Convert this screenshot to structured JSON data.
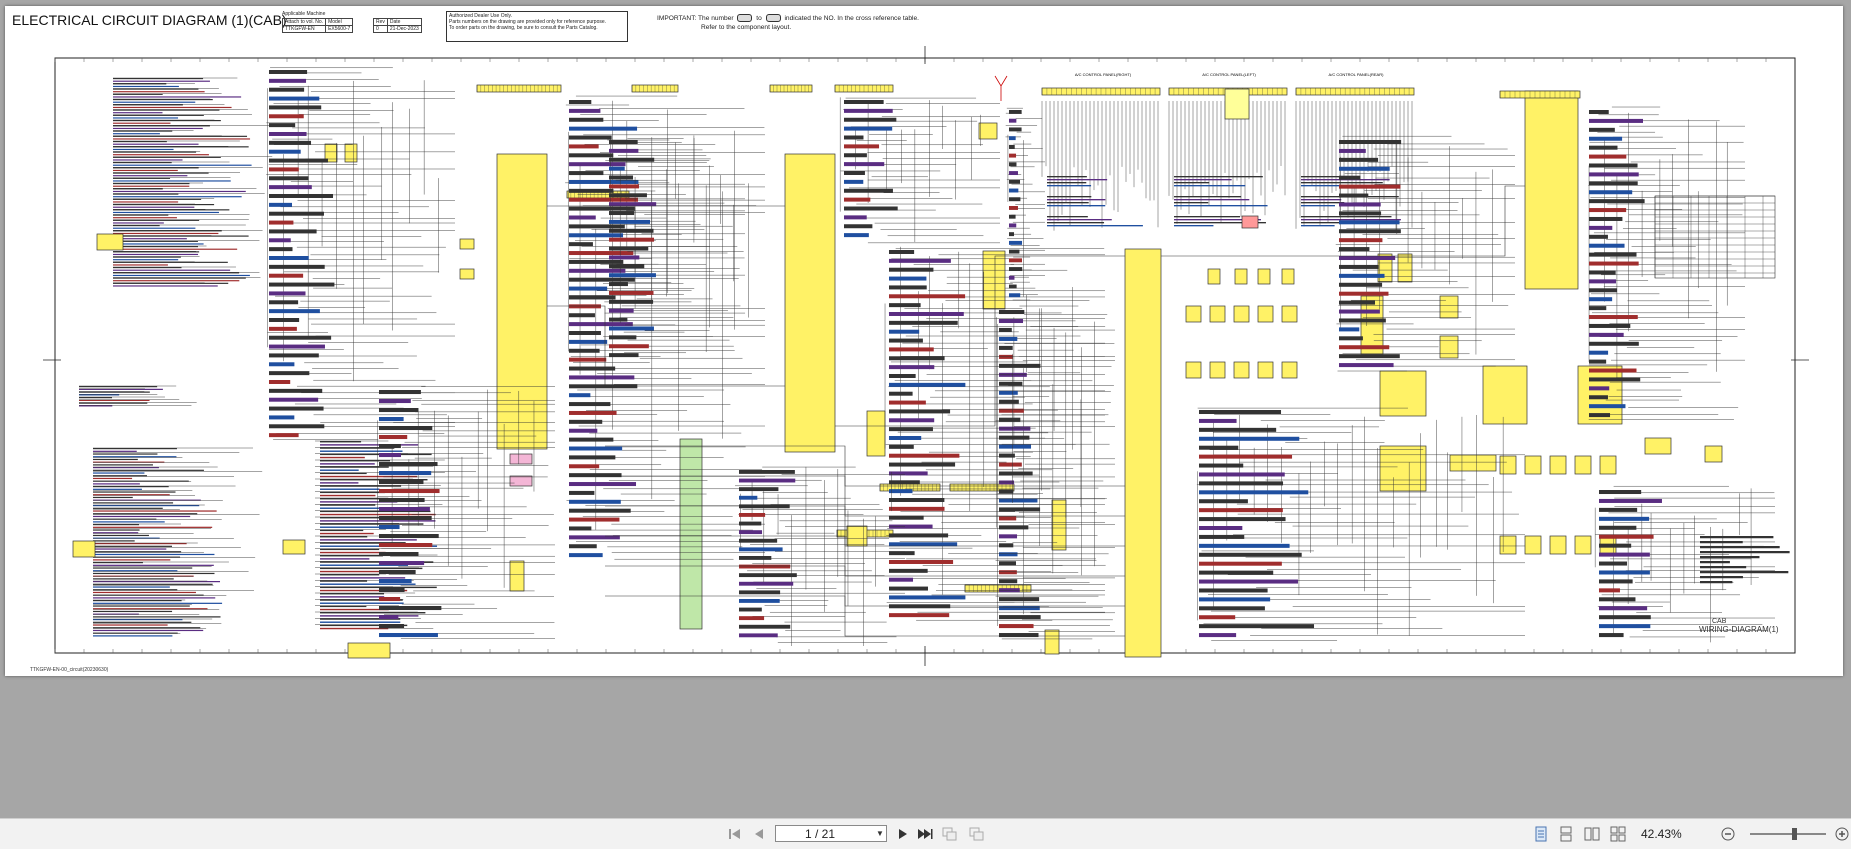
{
  "document": {
    "title": "ELECTRICAL CIRCUIT DIAGRAM (1)(CAB)",
    "applicable_machine_label": "Applicable Machine",
    "info_headers": [
      "Attach to vol. No.",
      "Model",
      "Rev",
      "Date"
    ],
    "info_values": [
      "TTKGFW-EN",
      "EX5600-7",
      "0",
      "21-Dec-2023"
    ],
    "dealer_note": [
      "Authorized Dealer Use Only.",
      "Parts numbers on the drawing are provided only for reference purpose.",
      "To order parts on the drawing, be sure to consult the Parts Catalog."
    ],
    "important_line1_a": "IMPORTANT: The number",
    "important_line1_b": "to",
    "important_line1_c": "indicated the NO. In the cross reference table.",
    "important_line2": "Refer to the component layout.",
    "footer_id": "TTKGFW-EN-00_circuit(20230630)",
    "panel_labels": [
      "A/C CONTROL PANEL(RIGHT)",
      "A/C CONTROL PANEL(LEFT)",
      "A/C CONTROL PANEL(REAR)"
    ],
    "footer_section": "CAB",
    "footer_diagram": "WIRING-DIAGRAM(1)"
  },
  "toolbar": {
    "page_value": "1 / 21",
    "zoom_value": "42.43%"
  },
  "icons": {
    "first": "first-page-icon",
    "prev": "prev-page-icon",
    "next": "next-page-icon",
    "last": "last-page-icon",
    "back": "previous-view-icon",
    "forward": "next-view-icon",
    "single": "single-page-view-icon",
    "continuous": "continuous-view-icon",
    "facing": "facing-view-icon",
    "cont_facing": "continuous-facing-view-icon",
    "zoom_out": "zoom-out-icon",
    "zoom_in": "zoom-in-icon"
  },
  "colors": {
    "component_yellow": "#fff266",
    "component_pink": "#f4b6d6",
    "component_green": "#bfe7a8",
    "viewer_bg": "#a6a6a6"
  }
}
